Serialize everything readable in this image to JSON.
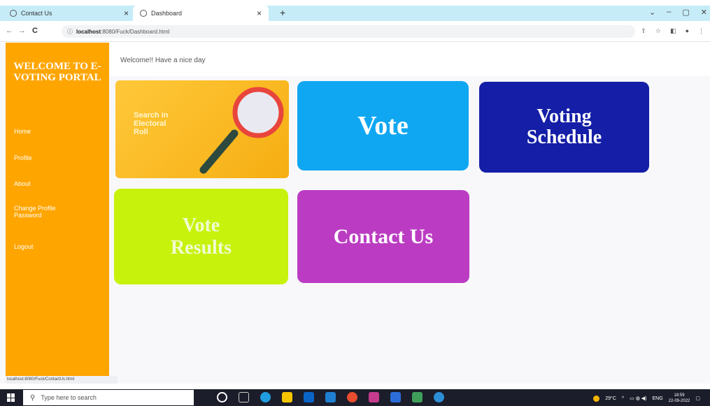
{
  "browser": {
    "tabs": [
      {
        "label": "Contact Us"
      },
      {
        "label": "Dashboard"
      }
    ],
    "url_host": "localhost",
    "url_path": ":8080/Fuck/Dashboard.html",
    "status_url": "localhost:8080/Fuck/ContactUs.html"
  },
  "sidebar": {
    "title": "WELCOME TO E-VOTING PORTAL",
    "items": [
      {
        "label": "Home"
      },
      {
        "label": "Profile"
      },
      {
        "label": "About"
      },
      {
        "label": "Change Profile Password"
      },
      {
        "label": "Logout"
      }
    ]
  },
  "header": {
    "welcome_message": "Welcome!! Have a nice day"
  },
  "cards": {
    "search": "Search in Electoral Roll",
    "vote": "Vote",
    "schedule": "Voting Schedule",
    "results": "Vote Results",
    "contact": "Contact Us"
  },
  "taskbar": {
    "search_placeholder": "Type here to search",
    "temperature": "29°C",
    "language": "ENG",
    "time": "18:59",
    "date": "22-09-2022"
  },
  "colors": {
    "sidebar": "#ffa500",
    "vote_card": "#0fa7f2",
    "schedule_card": "#141ea6",
    "results_card": "#c7f20c",
    "contact_card": "#bb3cc2",
    "search_card": "#f6ae12"
  }
}
